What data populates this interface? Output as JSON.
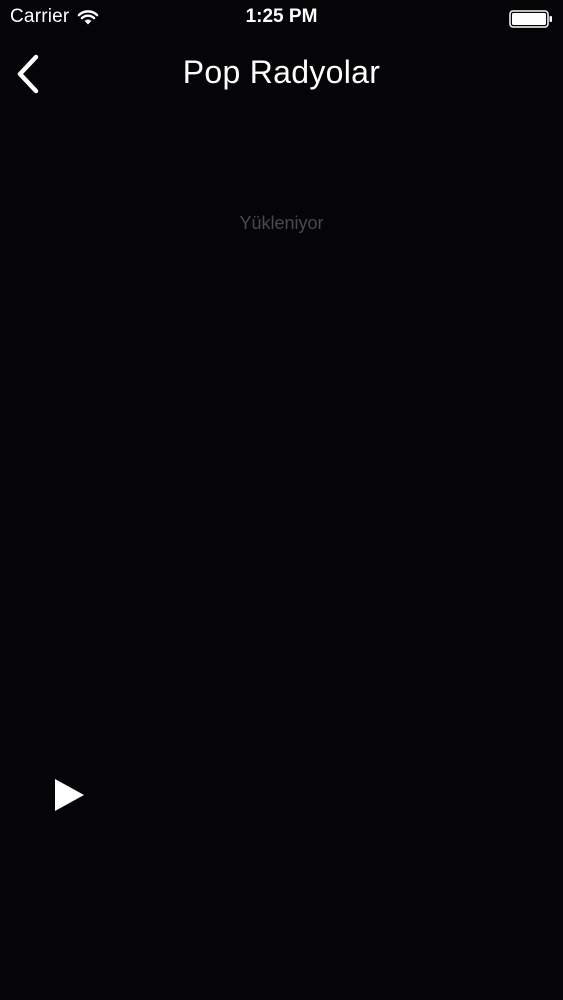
{
  "status_bar": {
    "carrier": "Carrier",
    "time": "1:25 PM",
    "icons": [
      "wifi-icon",
      "battery-icon"
    ]
  },
  "nav": {
    "title": "Pop Radyolar",
    "back_icon": "chevron-left-icon"
  },
  "content": {
    "loading_text": "Yükleniyor"
  },
  "player": {
    "play_icon": "play-icon"
  },
  "colors": {
    "background": "#050407",
    "foreground": "#ffffff",
    "loading_text": "#4a4a4e"
  }
}
